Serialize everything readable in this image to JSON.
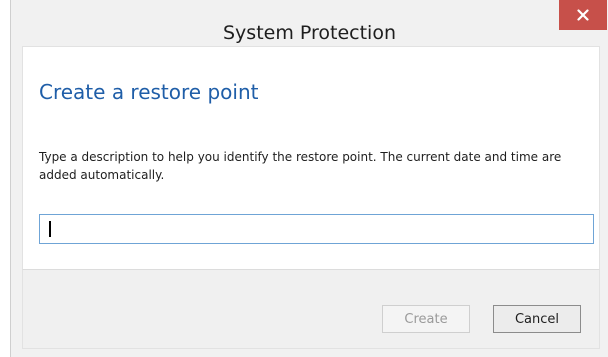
{
  "window": {
    "title": "System Protection"
  },
  "content": {
    "heading": "Create a restore point",
    "description": "Type a description to help you identify the restore point. The current date and time are added automatically.",
    "description_input": {
      "value": "",
      "placeholder": ""
    }
  },
  "footer": {
    "create_label": "Create",
    "create_enabled": false,
    "cancel_label": "Cancel"
  },
  "icons": {
    "close": "close-icon"
  },
  "colors": {
    "close_button": "#c7504a",
    "heading": "#1f5ea8",
    "input_border": "#6fa4d6",
    "disabled_text": "#9a9a9a"
  }
}
